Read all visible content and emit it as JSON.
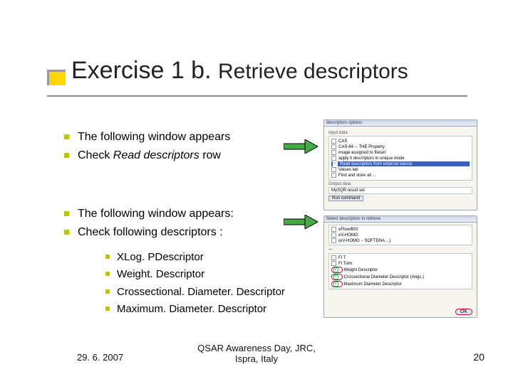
{
  "title": {
    "main": "Exercise 1 b.",
    "sub": "Retrieve descriptors"
  },
  "section1": {
    "b1": "The following window appears",
    "b2_pre": "Check ",
    "b2_em": "Read descriptors",
    "b2_post": " row"
  },
  "section2": {
    "b1": "The following window appears:",
    "b2": "Check following descriptors :",
    "subs": {
      "s1": "XLog. PDescriptor",
      "s2": "Weight. Descriptor",
      "s3": "Crossectional. Diameter. Descriptor",
      "s4": "Maximum. Diameter. Descriptor"
    }
  },
  "screenshot1": {
    "title": "descriptors options",
    "group": "Input data",
    "r1": "CAS",
    "r2": "CAS-64 ─ THE Property",
    "r3": "image assigned to fileset",
    "r4": "apply it descriptors in unique mode",
    "r5": "Read descriptors from external source",
    "r6": "Values lab",
    "r7": "Find and store all ...",
    "out": "Output data",
    "outval": "MySQR result set",
    "btn": "Run command"
  },
  "screenshot2": {
    "title": "Select descriptors to retrieve",
    "h1": "eFlow/BIS",
    "h2": "eV-HOMO",
    "h3": "(eV-HOMO − SOFTDNA ...)",
    "h4": "---",
    "d1": "FI T",
    "d2": "FI Tsim",
    "d3": "Weight Descriptor",
    "d4": "Crossectional Diameter Descriptor (Angs.)",
    "d5": "Maximum Diameter Descriptor",
    "ok": "OK"
  },
  "footer": {
    "date": "29. 6. 2007",
    "center1": "QSAR Awareness Day, JRC,",
    "center2": "Ispra, Italy",
    "page": "20"
  }
}
